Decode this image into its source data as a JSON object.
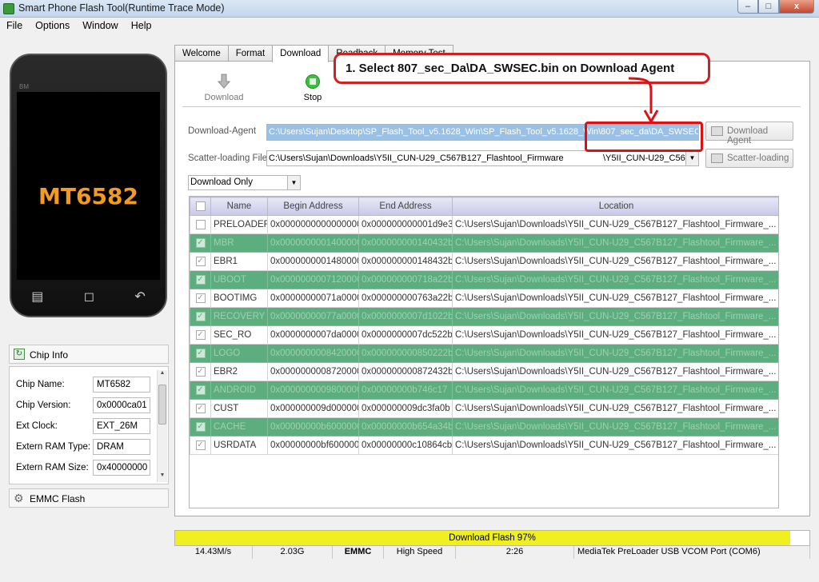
{
  "window": {
    "title": "Smart Phone Flash Tool(Runtime Trace Mode)",
    "buttons": {
      "min": "–",
      "max": "□",
      "close": "x"
    }
  },
  "menu": [
    "File",
    "Options",
    "Window",
    "Help"
  ],
  "phone": {
    "brand": "BM",
    "chip_label": "MT6582"
  },
  "chip_info": {
    "title": "Chip Info",
    "rows": [
      {
        "key": "Chip Name:",
        "value": "MT6582"
      },
      {
        "key": "Chip Version:",
        "value": "0x0000ca01"
      },
      {
        "key": "Ext Clock:",
        "value": "EXT_26M"
      },
      {
        "key": "Extern RAM Type:",
        "value": "DRAM"
      },
      {
        "key": "Extern RAM Size:",
        "value": "0x40000000"
      }
    ]
  },
  "emmc": {
    "title": "EMMC Flash"
  },
  "tabs": [
    "Welcome",
    "Format",
    "Download",
    "Readback",
    "Memory Test"
  ],
  "toolbar": {
    "download_label": "Download",
    "stop_label": "Stop"
  },
  "download_agent": {
    "label": "Download-Agent",
    "value": "C:\\Users\\Sujan\\Desktop\\SP_Flash_Tool_v5.1628_Win\\SP_Flash_Tool_v5.1628_Win\\MT6582_Android_scatter\\807_sec_da\\DA_SWSEC.bin",
    "display": "C:\\Users\\Sujan\\Desktop\\SP_Flash_Tool_v5.1628_Win\\SP_Flash_Tool_v5.1628_Win\\807_sec_da\\DA_SWSEC.bin",
    "button": "Download Agent"
  },
  "scatter": {
    "label": "Scatter-loading File",
    "value_head": "C:\\Users\\Sujan\\Downloads\\Y5II_CUN-U29_C567B127_Flashtool_Firmware",
    "value_tail": "\\Y5II_CUN-U29_C567",
    "button": "Scatter-loading"
  },
  "mode": {
    "selected": "Download Only"
  },
  "table": {
    "headers": [
      "",
      "Name",
      "Begin Address",
      "End Address",
      "Location"
    ],
    "rows": [
      {
        "checked": false,
        "green": false,
        "name": "PRELOADER",
        "begin": "0x0000000000000000",
        "end": "0x000000000001d9e3",
        "loc": "C:\\Users\\Sujan\\Downloads\\Y5II_CUN-U29_C567B127_Flashtool_Firmware_..."
      },
      {
        "checked": true,
        "green": true,
        "name": "MBR",
        "begin": "0x0000000001400000",
        "end": "0x000000000140432b",
        "loc": "C:\\Users\\Sujan\\Downloads\\Y5II_CUN-U29_C567B127_Flashtool_Firmware_..."
      },
      {
        "checked": true,
        "green": false,
        "name": "EBR1",
        "begin": "0x0000000001480000",
        "end": "0x000000000148432b",
        "loc": "C:\\Users\\Sujan\\Downloads\\Y5II_CUN-U29_C567B127_Flashtool_Firmware_..."
      },
      {
        "checked": true,
        "green": true,
        "name": "UBOOT",
        "begin": "0x0000000007120000",
        "end": "0x000000000718a22b",
        "loc": "C:\\Users\\Sujan\\Downloads\\Y5II_CUN-U29_C567B127_Flashtool_Firmware_..."
      },
      {
        "checked": true,
        "green": false,
        "name": "BOOTIMG",
        "begin": "0x00000000071a0000",
        "end": "0x000000000763a22b",
        "loc": "C:\\Users\\Sujan\\Downloads\\Y5II_CUN-U29_C567B127_Flashtool_Firmware_..."
      },
      {
        "checked": true,
        "green": true,
        "name": "RECOVERY",
        "begin": "0x00000000077a0000",
        "end": "0x0000000007d1022b",
        "loc": "C:\\Users\\Sujan\\Downloads\\Y5II_CUN-U29_C567B127_Flashtool_Firmware_..."
      },
      {
        "checked": true,
        "green": false,
        "name": "SEC_RO",
        "begin": "0x0000000007da0000",
        "end": "0x0000000007dc522b",
        "loc": "C:\\Users\\Sujan\\Downloads\\Y5II_CUN-U29_C567B127_Flashtool_Firmware_..."
      },
      {
        "checked": true,
        "green": true,
        "name": "LOGO",
        "begin": "0x0000000008420000",
        "end": "0x000000000850222b",
        "loc": "C:\\Users\\Sujan\\Downloads\\Y5II_CUN-U29_C567B127_Flashtool_Firmware_..."
      },
      {
        "checked": true,
        "green": false,
        "name": "EBR2",
        "begin": "0x0000000008720000",
        "end": "0x000000000872432b",
        "loc": "C:\\Users\\Sujan\\Downloads\\Y5II_CUN-U29_C567B127_Flashtool_Firmware_..."
      },
      {
        "checked": true,
        "green": true,
        "name": "ANDROID",
        "begin": "0x0000000009800000",
        "end": "0x00000000b746c17",
        "loc": "C:\\Users\\Sujan\\Downloads\\Y5II_CUN-U29_C567B127_Flashtool_Firmware_..."
      },
      {
        "checked": true,
        "green": false,
        "name": "CUST",
        "begin": "0x000000009d000000",
        "end": "0x000000009dc3fa0b",
        "loc": "C:\\Users\\Sujan\\Downloads\\Y5II_CUN-U29_C567B127_Flashtool_Firmware_..."
      },
      {
        "checked": true,
        "green": true,
        "name": "CACHE",
        "begin": "0x00000000b6000000",
        "end": "0x00000000b654a34b",
        "loc": "C:\\Users\\Sujan\\Downloads\\Y5II_CUN-U29_C567B127_Flashtool_Firmware_..."
      },
      {
        "checked": true,
        "green": false,
        "name": "USRDATA",
        "begin": "0x00000000bf600000",
        "end": "0x00000000c10864cb",
        "loc": "C:\\Users\\Sujan\\Downloads\\Y5II_CUN-U29_C567B127_Flashtool_Firmware_..."
      }
    ]
  },
  "callout": {
    "text": "1. Select 807_sec_Da\\DA_SWSEC.bin on Download Agent"
  },
  "progress": {
    "label": "Download Flash 97%",
    "fraction": 0.97
  },
  "status": [
    "14.43M/s",
    "2.03G",
    "EMMC",
    "High Speed",
    "2:26",
    "MediaTek PreLoader USB VCOM Port (COM6)"
  ],
  "colors": {
    "row_green": "#5cae7e",
    "progress": "#f0f020",
    "callout_red": "#cc2222",
    "chip_text": "#f29a22"
  }
}
